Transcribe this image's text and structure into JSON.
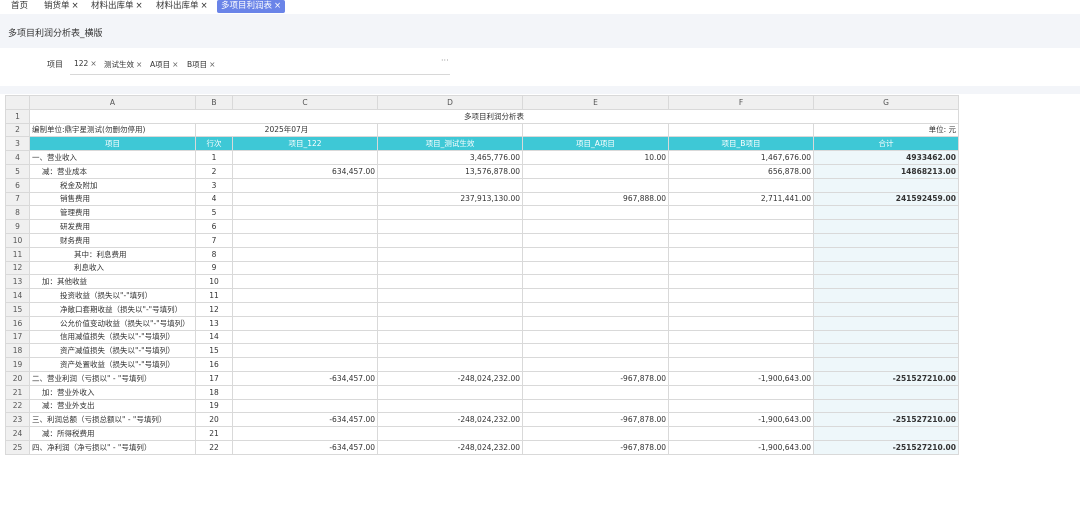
{
  "tabs": [
    {
      "label": "首页",
      "close": ""
    },
    {
      "label": "销货单",
      "close": "×"
    },
    {
      "label": "材料出库单",
      "close": "×"
    },
    {
      "label": "材料出库单",
      "close": "×"
    },
    {
      "label": "多项目利润表",
      "close": "×"
    }
  ],
  "page_title": "多项目利润分析表_横版",
  "filter": {
    "label": "项目",
    "chips": [
      {
        "label": "122",
        "close": "×"
      },
      {
        "label": "测试生效",
        "close": "×"
      },
      {
        "label": "A项目",
        "close": "×"
      },
      {
        "label": "B项目",
        "close": "×"
      }
    ],
    "more": "···"
  },
  "sheet": {
    "columns": [
      "A",
      "B",
      "C",
      "D",
      "E",
      "F",
      "G"
    ],
    "title": "多项目利润分析表",
    "unit_row": {
      "org": "编制单位:鼎宇星测试(勿删勿停用)",
      "period": "2025年07月",
      "unit": "单位: 元"
    },
    "header": {
      "item": "项目",
      "row_no": "行次",
      "c": "项目_122",
      "d": "项目_测试生效",
      "e": "项目_A项目",
      "f": "项目_B项目",
      "total": "合计"
    },
    "rows": [
      {
        "n": "4",
        "item": "一、营业收入",
        "ind": 0,
        "no": "1",
        "c": "",
        "d": "3,465,776.00",
        "e": "10.00",
        "f": "1,467,676.00",
        "g": "4933462.00"
      },
      {
        "n": "5",
        "item": "减：营业成本",
        "ind": 1,
        "no": "2",
        "c": "634,457.00",
        "d": "13,576,878.00",
        "e": "",
        "f": "656,878.00",
        "g": "14868213.00"
      },
      {
        "n": "6",
        "item": "税金及附加",
        "ind": 2,
        "no": "3",
        "c": "",
        "d": "",
        "e": "",
        "f": "",
        "g": ""
      },
      {
        "n": "7",
        "item": "销售费用",
        "ind": 2,
        "no": "4",
        "c": "",
        "d": "237,913,130.00",
        "e": "967,888.00",
        "f": "2,711,441.00",
        "g": "241592459.00"
      },
      {
        "n": "8",
        "item": "管理费用",
        "ind": 2,
        "no": "5",
        "c": "",
        "d": "",
        "e": "",
        "f": "",
        "g": ""
      },
      {
        "n": "9",
        "item": "研发费用",
        "ind": 2,
        "no": "6",
        "c": "",
        "d": "",
        "e": "",
        "f": "",
        "g": ""
      },
      {
        "n": "10",
        "item": "财务费用",
        "ind": 2,
        "no": "7",
        "c": "",
        "d": "",
        "e": "",
        "f": "",
        "g": ""
      },
      {
        "n": "11",
        "item": "其中：利息费用",
        "ind": 3,
        "no": "8",
        "c": "",
        "d": "",
        "e": "",
        "f": "",
        "g": ""
      },
      {
        "n": "12",
        "item": "利息收入",
        "ind": 3,
        "no": "9",
        "c": "",
        "d": "",
        "e": "",
        "f": "",
        "g": ""
      },
      {
        "n": "13",
        "item": "加：其他收益",
        "ind": 1,
        "no": "10",
        "c": "",
        "d": "",
        "e": "",
        "f": "",
        "g": ""
      },
      {
        "n": "14",
        "item": "投资收益（损失以\"-\"填列）",
        "ind": 2,
        "no": "11",
        "c": "",
        "d": "",
        "e": "",
        "f": "",
        "g": ""
      },
      {
        "n": "15",
        "item": "净敞口套期收益（损失以\"-\"号填列）",
        "ind": 2,
        "no": "12",
        "c": "",
        "d": "",
        "e": "",
        "f": "",
        "g": ""
      },
      {
        "n": "16",
        "item": "公允价值变动收益（损失以\"-\"号填列）",
        "ind": 2,
        "no": "13",
        "c": "",
        "d": "",
        "e": "",
        "f": "",
        "g": ""
      },
      {
        "n": "17",
        "item": "信用减值损失（损失以\"-\"号填列）",
        "ind": 2,
        "no": "14",
        "c": "",
        "d": "",
        "e": "",
        "f": "",
        "g": ""
      },
      {
        "n": "18",
        "item": "资产减值损失（损失以\"-\"号填列）",
        "ind": 2,
        "no": "15",
        "c": "",
        "d": "",
        "e": "",
        "f": "",
        "g": ""
      },
      {
        "n": "19",
        "item": "资产处置收益（损失以\"-\"号填列）",
        "ind": 2,
        "no": "16",
        "c": "",
        "d": "",
        "e": "",
        "f": "",
        "g": ""
      },
      {
        "n": "20",
        "item": "二、营业利润（亏损以\" - \"号填列）",
        "ind": 0,
        "no": "17",
        "c": "-634,457.00",
        "d": "-248,024,232.00",
        "e": "-967,878.00",
        "f": "-1,900,643.00",
        "g": "-251527210.00"
      },
      {
        "n": "21",
        "item": "加：营业外收入",
        "ind": 1,
        "no": "18",
        "c": "",
        "d": "",
        "e": "",
        "f": "",
        "g": ""
      },
      {
        "n": "22",
        "item": "减：营业外支出",
        "ind": 1,
        "no": "19",
        "c": "",
        "d": "",
        "e": "",
        "f": "",
        "g": ""
      },
      {
        "n": "23",
        "item": "三、利润总额（亏损总额以\" - \"号填列）",
        "ind": 0,
        "no": "20",
        "c": "-634,457.00",
        "d": "-248,024,232.00",
        "e": "-967,878.00",
        "f": "-1,900,643.00",
        "g": "-251527210.00"
      },
      {
        "n": "24",
        "item": "减：所得税费用",
        "ind": 1,
        "no": "21",
        "c": "",
        "d": "",
        "e": "",
        "f": "",
        "g": ""
      },
      {
        "n": "25",
        "item": "四、净利润（净亏损以\" - \"号填列）",
        "ind": 0,
        "no": "22",
        "c": "-634,457.00",
        "d": "-248,024,232.00",
        "e": "-967,878.00",
        "f": "-1,900,643.00",
        "g": "-251527210.00"
      }
    ]
  }
}
